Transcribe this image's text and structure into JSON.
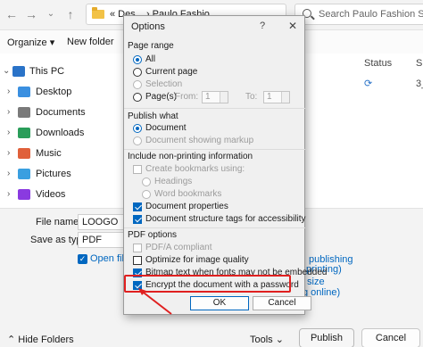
{
  "explorer": {
    "address": "« Des... › Paulo Fashio...",
    "search_placeholder": "Search Paulo Fashion Store",
    "toolbar": {
      "organize": "Organize ▾",
      "new_folder": "New folder"
    },
    "nav_items": [
      {
        "label": "This PC",
        "icon": "computer-icon",
        "color": "#2a73c8"
      },
      {
        "label": "Desktop",
        "icon": "desktop-folder-icon",
        "color": "#3a8fe0"
      },
      {
        "label": "Documents",
        "icon": "documents-folder-icon",
        "color": "#7a7a7a"
      },
      {
        "label": "Downloads",
        "icon": "downloads-folder-icon",
        "color": "#2a9d5a"
      },
      {
        "label": "Music",
        "icon": "music-folder-icon",
        "color": "#e0603a"
      },
      {
        "label": "Pictures",
        "icon": "pictures-folder-icon",
        "color": "#3a9fe0"
      },
      {
        "label": "Videos",
        "icon": "videos-folder-icon",
        "color": "#8a3ae0"
      }
    ],
    "columns": {
      "status": "Status",
      "size_fragment": "S"
    },
    "row_value": "3_",
    "file_name_label": "File name:",
    "file_name_value": "LOOGO",
    "save_type_label": "Save as type:",
    "save_type_value": "PDF",
    "open_file_fragment": "Open file",
    "right_fragments": [
      "publishing",
      "printing)",
      "size",
      "g online)"
    ],
    "hide_folders": "Hide Folders",
    "tools": "Tools",
    "publish": "Publish",
    "cancel": "Cancel"
  },
  "dialog": {
    "title": "Options",
    "help": "?",
    "close": "✕",
    "page_range": {
      "label": "Page range",
      "all": "All",
      "current_page": "Current page",
      "selection": "Selection",
      "pages": "Page(s)",
      "from_label": "From:",
      "from_value": "1",
      "to_label": "To:",
      "to_value": "1"
    },
    "publish_what": {
      "label": "Publish what",
      "document": "Document",
      "document_markup": "Document showing markup"
    },
    "non_printing": {
      "label": "Include non-printing information",
      "create_bookmarks": "Create bookmarks using:",
      "headings": "Headings",
      "word_bookmarks": "Word bookmarks",
      "doc_properties": "Document properties",
      "doc_structure": "Document structure tags for accessibility"
    },
    "pdf_options": {
      "label": "PDF options",
      "pdfa": "PDF/A compliant",
      "optimize_image": "Optimize for image quality",
      "bitmap_text": "Bitmap text when fonts may not be embedded",
      "encrypt": "Encrypt the document with a password"
    },
    "ok": "OK",
    "cancel": "Cancel"
  },
  "colors": {
    "accent": "#0067c0",
    "annotation": "#e02020"
  }
}
